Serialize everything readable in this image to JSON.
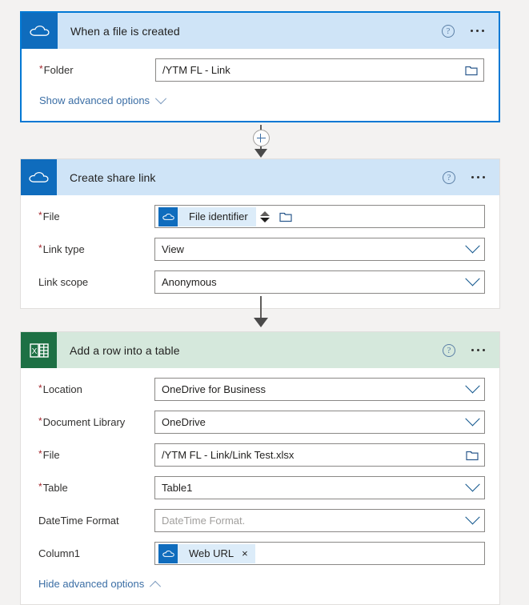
{
  "colors": {
    "selected_border": "#0078d4",
    "onedrive_icon_bg": "#0f6cbd",
    "onedrive_header_bg": "#cfe4f7",
    "excel_icon_bg": "#1d7044",
    "excel_header_bg": "#d5e8dc",
    "required_asterisk": "#a4262c",
    "link_text": "#3b6ea5",
    "canvas_bg": "#f3f2f1"
  },
  "cards": [
    {
      "id": "when-a-file-is-created",
      "title": "When a file is created",
      "connector_type": "onedrive",
      "selected": true,
      "help_icon": "help-circle-icon",
      "menu_icon": "ellipsis-icon",
      "fields": [
        {
          "label": "Folder",
          "required": true,
          "value": "/YTM FL - Link",
          "control": "text",
          "trailing_icons": [
            "folder-picker-icon"
          ]
        }
      ],
      "advanced_toggle": {
        "label": "Show advanced options",
        "state": "collapsed",
        "icon": "chevron-down-icon"
      }
    },
    {
      "id": "create-share-link",
      "title": "Create share link",
      "connector_type": "onedrive",
      "selected": false,
      "help_icon": "help-circle-icon",
      "menu_icon": "ellipsis-icon",
      "fields": [
        {
          "label": "File",
          "required": true,
          "control": "token",
          "token": {
            "label": "File identifier",
            "icon": "onedrive-icon",
            "removable": false
          },
          "trailing_icons": [
            "spinner-updown-icon",
            "folder-picker-icon"
          ]
        },
        {
          "label": "Link type",
          "required": true,
          "value": "View",
          "control": "dropdown",
          "trailing_icons": [
            "chevron-down-icon"
          ]
        },
        {
          "label": "Link scope",
          "required": false,
          "value": "Anonymous",
          "control": "dropdown",
          "trailing_icons": [
            "chevron-down-icon"
          ]
        }
      ],
      "advanced_toggle": null
    },
    {
      "id": "add-a-row-into-a-table",
      "title": "Add a row into a table",
      "connector_type": "excel",
      "selected": false,
      "help_icon": "help-circle-icon",
      "menu_icon": "ellipsis-icon",
      "fields": [
        {
          "label": "Location",
          "required": true,
          "value": "OneDrive for Business",
          "control": "dropdown",
          "trailing_icons": [
            "chevron-down-icon"
          ]
        },
        {
          "label": "Document Library",
          "required": true,
          "value": "OneDrive",
          "control": "dropdown",
          "trailing_icons": [
            "chevron-down-icon"
          ]
        },
        {
          "label": "File",
          "required": true,
          "value": "/YTM FL - Link/Link Test.xlsx",
          "control": "text",
          "trailing_icons": [
            "folder-picker-icon"
          ]
        },
        {
          "label": "Table",
          "required": true,
          "value": "Table1",
          "control": "dropdown",
          "trailing_icons": [
            "chevron-down-icon"
          ]
        },
        {
          "label": "DateTime Format",
          "required": false,
          "value": "",
          "placeholder": "DateTime Format.",
          "control": "dropdown",
          "trailing_icons": [
            "chevron-down-icon"
          ]
        },
        {
          "label": "Column1",
          "required": false,
          "control": "token",
          "token": {
            "label": "Web URL",
            "icon": "onedrive-icon",
            "removable": true,
            "remove_glyph": "×"
          },
          "trailing_icons": []
        }
      ],
      "advanced_toggle": {
        "label": "Hide advanced options",
        "state": "expanded",
        "icon": "chevron-up-icon"
      }
    }
  ],
  "connectors": [
    {
      "id": "connector-1",
      "has_add_button": true,
      "add_button_glyph": "+",
      "arrow": "arrow-down-icon"
    },
    {
      "id": "connector-2",
      "has_add_button": false,
      "arrow": "arrow-down-icon"
    }
  ]
}
